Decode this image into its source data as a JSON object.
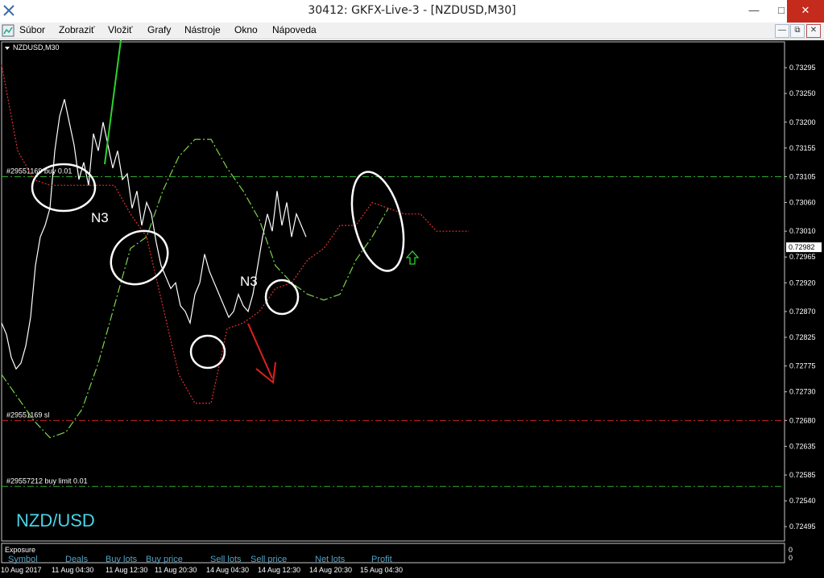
{
  "window": {
    "title": "30412: GKFX-Live-3 - [NZDUSD,M30]"
  },
  "menu": {
    "items": [
      "Súbor",
      "Zobraziť",
      "Vložiť",
      "Grafy",
      "Nástroje",
      "Okno",
      "Nápoveda"
    ]
  },
  "chart_data": {
    "type": "line",
    "symbol_label": "NZDUSD,M30",
    "watermark": "NZD/USD",
    "current_price_label": "0.72982",
    "price_axis_labels": [
      "0.73295",
      "0.73250",
      "0.73200",
      "0.73155",
      "0.73105",
      "0.73060",
      "0.73010",
      "0.72965",
      "0.72920",
      "0.72870",
      "0.72825",
      "0.72775",
      "0.72730",
      "0.72680",
      "0.72635",
      "0.72585",
      "0.72540",
      "0.72495"
    ],
    "time_axis_labels": [
      "10 Aug 2017",
      "11 Aug 04:30",
      "11 Aug 12:30",
      "11 Aug 20:30",
      "14 Aug 04:30",
      "14 Aug 12:30",
      "14 Aug 20:30",
      "15 Aug 04:30"
    ],
    "order_lines": [
      {
        "label": "#29551169 buy 0.01",
        "price": 0.73105,
        "color": "#2eaa2e"
      },
      {
        "label": "#29551169 sl",
        "price": 0.7268,
        "color": "#cc2222"
      },
      {
        "label": "#29557212 buy limit 0.01",
        "price": 0.72565,
        "color": "#2eaa2e"
      }
    ],
    "annotations": [
      "N3",
      "N3"
    ],
    "series": [
      {
        "name": "",
        "color": "#ffffff",
        "style": "solid",
        "x": [
          0,
          6,
          12,
          18,
          24,
          30,
          36,
          42,
          48,
          54,
          60,
          66,
          72,
          78,
          84,
          90,
          96,
          102,
          108,
          114,
          120,
          126,
          132,
          138,
          144,
          150,
          156,
          162,
          168,
          174,
          180,
          186,
          192,
          198,
          204,
          210,
          216,
          222,
          228,
          234,
          240,
          246,
          252,
          258,
          264,
          270,
          276,
          282,
          288,
          294,
          300,
          306,
          312,
          318,
          324,
          330,
          336,
          342,
          348,
          354,
          360,
          366,
          372,
          378
        ],
        "y": [
          0.7285,
          0.7283,
          0.7279,
          0.7277,
          0.7278,
          0.7281,
          0.7286,
          0.7295,
          0.73,
          0.7302,
          0.7305,
          0.7315,
          0.7321,
          0.7324,
          0.732,
          0.7316,
          0.731,
          0.7313,
          0.7309,
          0.7318,
          0.7315,
          0.732,
          0.7316,
          0.7312,
          0.7315,
          0.731,
          0.7311,
          0.7305,
          0.7308,
          0.7302,
          0.7306,
          0.7304,
          0.7299,
          0.7295,
          0.7293,
          0.7291,
          0.7292,
          0.7288,
          0.7287,
          0.7285,
          0.729,
          0.7292,
          0.7297,
          0.7294,
          0.7292,
          0.729,
          0.7288,
          0.7286,
          0.7287,
          0.729,
          0.7288,
          0.7287,
          0.729,
          0.7295,
          0.73,
          0.7304,
          0.7301,
          0.7308,
          0.7302,
          0.7306,
          0.73,
          0.7304,
          0.7302,
          0.73
        ]
      },
      {
        "name": "",
        "color": "#7bd34a",
        "style": "dash",
        "x": [
          0,
          20,
          40,
          60,
          80,
          100,
          120,
          140,
          160,
          180,
          200,
          220,
          240,
          260,
          280,
          300,
          320,
          340,
          360,
          380,
          400,
          420,
          440,
          460,
          480
        ],
        "y": [
          0.7276,
          0.7272,
          0.7268,
          0.7265,
          0.7266,
          0.727,
          0.7278,
          0.7288,
          0.7298,
          0.73,
          0.7308,
          0.7314,
          0.7317,
          0.7317,
          0.7312,
          0.7308,
          0.7303,
          0.7295,
          0.7292,
          0.729,
          0.7289,
          0.729,
          0.7296,
          0.73,
          0.7305
        ]
      },
      {
        "name": "",
        "color": "#e03030",
        "style": "dot",
        "x": [
          0,
          20,
          40,
          60,
          80,
          100,
          120,
          140,
          160,
          180,
          200,
          220,
          240,
          260,
          280,
          300,
          320,
          340,
          360,
          380,
          400,
          420,
          440,
          460,
          480,
          500,
          520,
          540,
          560,
          580
        ],
        "y": [
          0.733,
          0.7315,
          0.731,
          0.7309,
          0.7309,
          0.7309,
          0.7309,
          0.7309,
          0.7304,
          0.73,
          0.7288,
          0.7276,
          0.7271,
          0.7271,
          0.7284,
          0.7285,
          0.7287,
          0.7291,
          0.7292,
          0.7296,
          0.7298,
          0.7302,
          0.7302,
          0.7306,
          0.7305,
          0.7304,
          0.7304,
          0.7301,
          0.7301,
          0.7301
        ]
      }
    ],
    "ylim": [
      0.7247,
      0.7334
    ]
  },
  "exposure": {
    "title": "Exposure",
    "columns": [
      "Symbol",
      "Deals",
      "Buy lots",
      "Buy price",
      "Sell lots",
      "Sell price",
      "Net lots",
      "Profit"
    ],
    "side_values": [
      "0",
      "0"
    ]
  },
  "colors": {
    "background": "#000000",
    "grid": "#1c1c1c",
    "axis_text": "#ffffff",
    "watermark": "#49d4e6"
  }
}
